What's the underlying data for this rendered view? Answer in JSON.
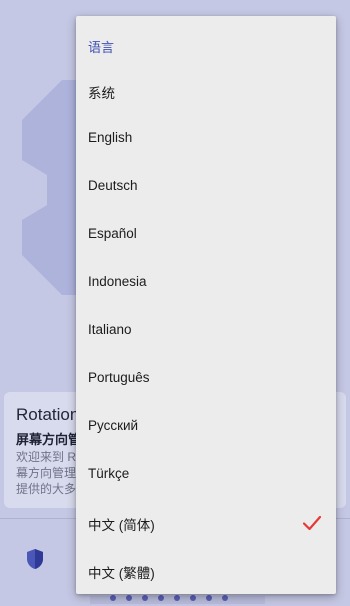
{
  "background": {
    "card_title": "Rotation",
    "card_subtitle": "屏幕方向管",
    "card_body_lines": [
      "欢迎来到 R",
      "幕方向管理",
      "提供的大多"
    ]
  },
  "menu": {
    "header": "语言",
    "items": [
      {
        "label": "系统"
      },
      {
        "label": "English"
      },
      {
        "label": "Deutsch"
      },
      {
        "label": "Español"
      },
      {
        "label": "Indonesia"
      },
      {
        "label": "Italiano"
      },
      {
        "label": "Português"
      },
      {
        "label": "Русский"
      },
      {
        "label": "Türkçe"
      },
      {
        "label": "中文 (简体)",
        "selected": true
      },
      {
        "label": "中文 (繁體)"
      }
    ],
    "selected_index": 9
  },
  "colors": {
    "accent": "#3f51b5",
    "check": "#e53935",
    "menu_bg": "#ececec",
    "scrim": "#c5c8e4"
  },
  "icons": {
    "selected_marker": "check-icon",
    "nav_icon": "shield-icon",
    "hero_graphic": "gear-icon"
  }
}
